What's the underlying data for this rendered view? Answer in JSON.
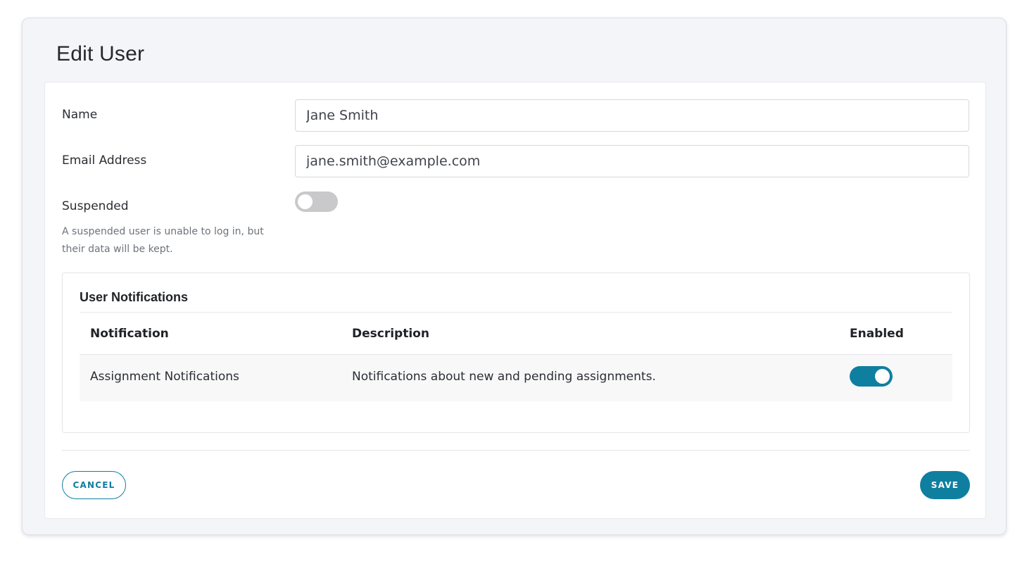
{
  "modal": {
    "title": "Edit User"
  },
  "form": {
    "name_label": "Name",
    "name_value": "Jane Smith",
    "email_label": "Email Address",
    "email_value": "jane.smith@example.com",
    "suspended_label": "Suspended",
    "suspended_value": false,
    "suspended_hint": "A suspended user is unable to log in, but their data will be kept."
  },
  "notifications": {
    "title": "User Notifications",
    "columns": [
      "Notification",
      "Description",
      "Enabled"
    ],
    "rows": [
      {
        "name": "Assignment Notifications",
        "description": "Notifications about new and pending assignments.",
        "enabled": true
      }
    ]
  },
  "actions": {
    "cancel_label": "CANCEL",
    "save_label": "SAVE"
  },
  "colors": {
    "accent": "#0f7fa0",
    "toggle_off": "#c9c9cb",
    "modal_bg": "#f4f5f8"
  }
}
